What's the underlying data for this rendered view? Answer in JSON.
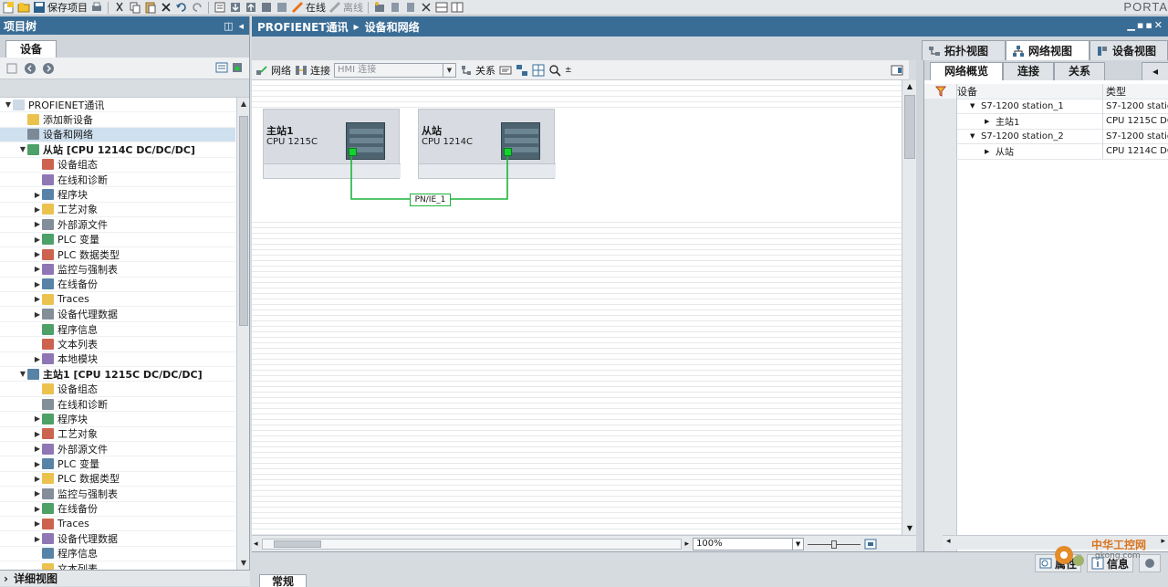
{
  "toolbar": {
    "save_project": "保存项目",
    "go_online": "在线",
    "go_offline": "离线"
  },
  "brand": "PORTA",
  "project_tree": {
    "title": "项目树",
    "tab": "设备",
    "items": [
      {
        "label": "PROFIENET通讯",
        "level": 0,
        "arrow": "▼"
      },
      {
        "label": "添加新设备",
        "level": 1,
        "arrow": ""
      },
      {
        "label": "设备和网络",
        "level": 1,
        "arrow": "",
        "selected": true
      },
      {
        "label": "从站 [CPU 1214C DC/DC/DC]",
        "level": 1,
        "arrow": "▼",
        "bold": true
      },
      {
        "label": "设备组态",
        "level": 2,
        "arrow": ""
      },
      {
        "label": "在线和诊断",
        "level": 2,
        "arrow": ""
      },
      {
        "label": "程序块",
        "level": 2,
        "arrow": "▶"
      },
      {
        "label": "工艺对象",
        "level": 2,
        "arrow": "▶"
      },
      {
        "label": "外部源文件",
        "level": 2,
        "arrow": "▶"
      },
      {
        "label": "PLC 变量",
        "level": 2,
        "arrow": "▶"
      },
      {
        "label": "PLC 数据类型",
        "level": 2,
        "arrow": "▶"
      },
      {
        "label": "监控与强制表",
        "level": 2,
        "arrow": "▶"
      },
      {
        "label": "在线备份",
        "level": 2,
        "arrow": "▶"
      },
      {
        "label": "Traces",
        "level": 2,
        "arrow": "▶"
      },
      {
        "label": "设备代理数据",
        "level": 2,
        "arrow": "▶"
      },
      {
        "label": "程序信息",
        "level": 2,
        "arrow": ""
      },
      {
        "label": "文本列表",
        "level": 2,
        "arrow": ""
      },
      {
        "label": "本地模块",
        "level": 2,
        "arrow": "▶"
      },
      {
        "label": "主站1 [CPU 1215C DC/DC/DC]",
        "level": 1,
        "arrow": "▼",
        "bold": true
      },
      {
        "label": "设备组态",
        "level": 2,
        "arrow": ""
      },
      {
        "label": "在线和诊断",
        "level": 2,
        "arrow": ""
      },
      {
        "label": "程序块",
        "level": 2,
        "arrow": "▶"
      },
      {
        "label": "工艺对象",
        "level": 2,
        "arrow": "▶"
      },
      {
        "label": "外部源文件",
        "level": 2,
        "arrow": "▶"
      },
      {
        "label": "PLC 变量",
        "level": 2,
        "arrow": "▶"
      },
      {
        "label": "PLC 数据类型",
        "level": 2,
        "arrow": "▶"
      },
      {
        "label": "监控与强制表",
        "level": 2,
        "arrow": "▶"
      },
      {
        "label": "在线备份",
        "level": 2,
        "arrow": "▶"
      },
      {
        "label": "Traces",
        "level": 2,
        "arrow": "▶"
      },
      {
        "label": "设备代理数据",
        "level": 2,
        "arrow": "▶"
      },
      {
        "label": "程序信息",
        "level": 2,
        "arrow": ""
      },
      {
        "label": "文本列表",
        "level": 2,
        "arrow": ""
      }
    ],
    "detail_view": "详细视图"
  },
  "main": {
    "breadcrumb_project": "PROFIENET通讯",
    "breadcrumb_sep": "▸",
    "breadcrumb_page": "设备和网络",
    "view_tabs": {
      "topology": "拓扑视图",
      "network": "网络视图",
      "device": "设备视图"
    },
    "net_toolbar": {
      "network": "网络",
      "connections": "连接",
      "hmi_connection_placeholder": "HMI 连接",
      "relations": "关系"
    },
    "devices": [
      {
        "name": "主站1",
        "cpu": "CPU 1215C"
      },
      {
        "name": "从站",
        "cpu": "CPU 1214C"
      }
    ],
    "network_label": "PN/IE_1",
    "zoom": "100%"
  },
  "overview": {
    "tabs": {
      "overview": "网络概览",
      "connections": "连接",
      "relations": "关系"
    },
    "col_device": "设备",
    "col_type": "类型",
    "rows": [
      {
        "device": "S7-1200 station_1",
        "type": "S7-1200 statio",
        "arrow": "▼",
        "indent": 0
      },
      {
        "device": "主站1",
        "type": "CPU 1215C DC",
        "arrow": "▶",
        "indent": 1
      },
      {
        "device": "S7-1200 station_2",
        "type": "S7-1200 statio",
        "arrow": "▼",
        "indent": 0
      },
      {
        "device": "从站",
        "type": "CPU 1214C DC",
        "arrow": "▶",
        "indent": 1
      }
    ]
  },
  "bottom": {
    "properties": "属性",
    "info": "信息",
    "general_tab": "常规"
  },
  "watermark": {
    "text": "中华工控网",
    "url": "gkong.com"
  },
  "colors": {
    "title_bar": "#3a6d96",
    "network_line": "#1db33a",
    "port": "#14d230"
  }
}
